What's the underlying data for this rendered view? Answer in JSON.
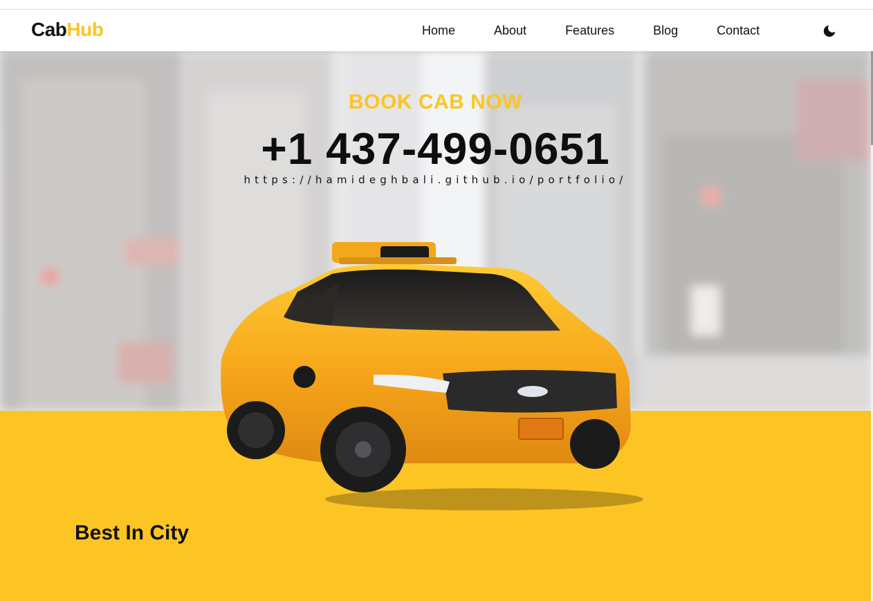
{
  "nav": {
    "logo": {
      "part1": "Cab",
      "part2": "Hub"
    },
    "links": [
      "Home",
      "About",
      "Features",
      "Blog",
      "Contact"
    ],
    "theme_icon": "moon-icon"
  },
  "hero": {
    "kicker": "BOOK CAB NOW",
    "phone": "+1 437-499-0651",
    "url": "https://hamideghbali.github.io/portfolio/",
    "image": "yellow-taxi-car",
    "background": "blurred-city-street"
  },
  "section": {
    "title": "Best In City"
  },
  "colors": {
    "accent": "#fbc524",
    "band": "#fdc524",
    "text": "#111111",
    "nav_bg": "#ffffff"
  }
}
